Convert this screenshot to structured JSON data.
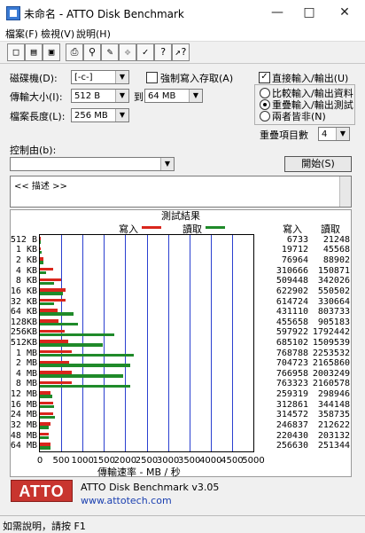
{
  "window": {
    "title": "未命名 - ATTO Disk Benchmark"
  },
  "menu": [
    "檔案(F)",
    "檢視(V)",
    "說明(H)"
  ],
  "form": {
    "drive_label": "磁碟機(D):",
    "drive_value": "[-c-]",
    "transfer_label": "傳輸大小(I):",
    "transfer_from": "512 B",
    "to_label": "到",
    "transfer_to": "64 MB",
    "length_label": "檔案長度(L):",
    "length_value": "256 MB",
    "force_write_label": "強制寫入存取(A)",
    "force_write_checked": false,
    "direct_io_label": "直接輸入/輸出(U)",
    "direct_io_checked": true,
    "radio_compare": "比較輸入/輸出資料",
    "radio_overlap": "重疊輸入/輸出測試",
    "radio_neither": "兩者皆非(N)",
    "queue_label": "重疊項目數",
    "queue_value": "4",
    "control_label": "控制由(b):",
    "control_value": "",
    "start_button": "開始(S)",
    "description": "<< 描述 >>"
  },
  "results": {
    "title": "測試結果",
    "write_legend": "寫入",
    "read_legend": "讀取",
    "write_col": "寫入",
    "read_col": "讀取",
    "xlabel": "傳輸速率 - MB / 秒",
    "write_color": "#d9261c",
    "read_color": "#1f8a2a"
  },
  "chart_data": {
    "type": "bar",
    "categories": [
      "512 B",
      "1 KB",
      "2 KB",
      "4 KB",
      "8 KB",
      "16 KB",
      "32 KB",
      "64 KB",
      "128KB",
      "256KB",
      "512KB",
      "1 MB",
      "2 MB",
      "4 MB",
      "8 MB",
      "12 MB",
      "16 MB",
      "24 MB",
      "32 MB",
      "48 MB",
      "64 MB"
    ],
    "series": [
      {
        "name": "寫入",
        "values": [
          6733,
          19712,
          76964,
          310666,
          509448,
          622902,
          614724,
          431110,
          455658,
          597922,
          685102,
          768788,
          704723,
          766958,
          763323,
          259319,
          312861,
          314572,
          246837,
          220430,
          256630
        ]
      },
      {
        "name": "讀取",
        "values": [
          21248,
          45568,
          88902,
          150871,
          342026,
          550502,
          330664,
          803733,
          905183,
          1792442,
          1509539,
          2253532,
          2165860,
          2003249,
          2160578,
          298946,
          344148,
          358735,
          212622,
          203132,
          251344
        ]
      }
    ],
    "bar_unit_note": "KB/s",
    "xlabel": "傳輸速率 - MB / 秒",
    "x_ticks": [
      "0",
      "500",
      "1000",
      "1500",
      "2000",
      "2500",
      "3000",
      "3500",
      "4000",
      "4500",
      "5000"
    ],
    "xlim": [
      0,
      5000
    ]
  },
  "footer": {
    "logo": "ATTO",
    "product": "ATTO Disk Benchmark v3.05",
    "url": "www.attotech.com"
  },
  "status": {
    "text": "如需說明，請按 F1"
  }
}
